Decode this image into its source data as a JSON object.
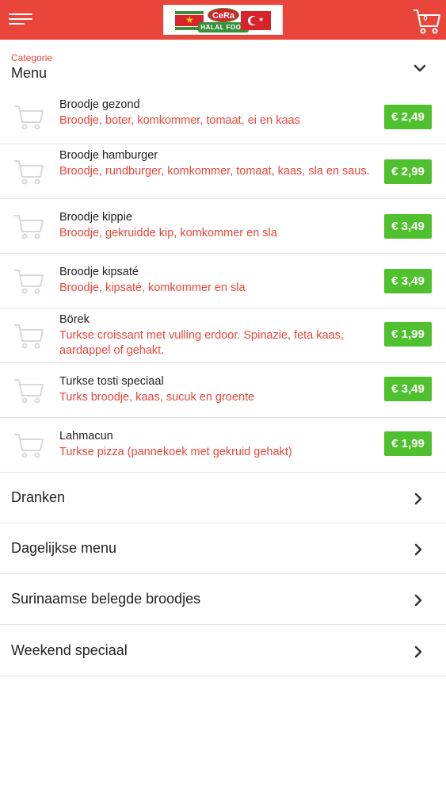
{
  "header": {
    "logo_text": "CeRa",
    "logo_tag": "HALAL FOOD",
    "cart_count": "0"
  },
  "category": {
    "label": "Categorie",
    "name": "Menu"
  },
  "items": [
    {
      "name": "Broodje gezond",
      "desc": "Broodje, boter, komkommer, tomaat, ei en kaas",
      "price": "€ 2,49"
    },
    {
      "name": "Broodje hamburger",
      "desc": "Broodje, rundburger, komkommer, tomaat, kaas, sla en saus.",
      "price": "€ 2,99"
    },
    {
      "name": "Broodje kippie",
      "desc": "Broodje, gekruidde kip, komkommer en sla",
      "price": "€ 3,49"
    },
    {
      "name": "Broodje kipsaté",
      "desc": "Broodje, kipsaté, komkommer en sla",
      "price": "€ 3,49"
    },
    {
      "name": "Börek",
      "desc": "Turkse croissant met vulling erdoor. Spinazie, feta kaas, aardappel of gehakt.",
      "price": "€ 1,99"
    },
    {
      "name": "Turkse tosti speciaal",
      "desc": "Turks broodje, kaas, sucuk en groente",
      "price": "€ 3,49"
    },
    {
      "name": "Lahmacun",
      "desc": "Turkse pizza (pannekoek met gekruid gehakt)",
      "price": "€ 1,99"
    }
  ],
  "categories": [
    {
      "label": "Dranken"
    },
    {
      "label": "Dagelijkse menu"
    },
    {
      "label": "Surinaamse belegde broodjes"
    },
    {
      "label": "Weekend speciaal"
    }
  ],
  "colors": {
    "header": "#e9453a",
    "accent_text": "#e9453a",
    "price_button": "#4fc12e"
  },
  "icons": {
    "menu": "hamburger-icon",
    "cart": "shopping-cart-icon",
    "item_cart": "shopping-cart-icon",
    "expand": "chevron-down-icon",
    "open": "chevron-right-icon"
  }
}
